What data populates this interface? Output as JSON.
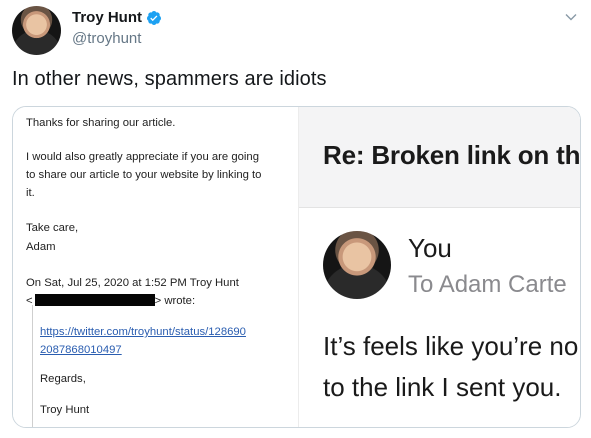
{
  "tweet": {
    "author": {
      "display_name": "Troy Hunt",
      "handle": "@troyhunt",
      "avatar_icon": "profile-photo",
      "verified_icon": "verified-badge-icon"
    },
    "menu_icon": "chevron-down-icon",
    "text": "In other news, spammers are idiots",
    "colors": {
      "verified": "#1da1f2",
      "handle": "#657786",
      "link": "#2a5db0"
    }
  },
  "email_left": {
    "line1": "Thanks for sharing our article.",
    "line2": "I would also greatly appreciate if you are going",
    "line3": "to share our article to your website by linking to",
    "line4": "it.",
    "signoff": "Take care,",
    "sender": "Adam",
    "quote_header_1": "On Sat, Jul 25, 2020 at 1:52 PM Troy Hunt",
    "quote_header_2_prefix": "<",
    "quote_header_2_suffix": "> wrote:",
    "link_line_1": "https://twitter.com/troyhunt/status/128690",
    "link_line_2": "2087868010497",
    "regards": "Regards,",
    "quoted_name": "Troy Hunt"
  },
  "email_right": {
    "subject": "Re: Broken link on th",
    "sender": "You",
    "recipient": "To Adam Carte",
    "body_line_1": "It’s feels like you’re no",
    "body_line_2": "to the link I sent you."
  }
}
